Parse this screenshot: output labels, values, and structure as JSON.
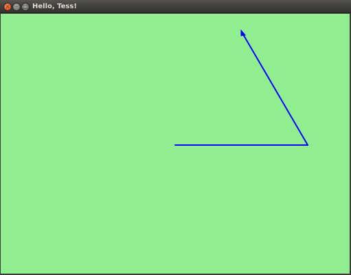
{
  "window": {
    "title": "Hello, Tess!",
    "controls": [
      {
        "name": "close",
        "glyph": "×"
      },
      {
        "name": "minimize",
        "glyph": "–"
      },
      {
        "name": "maximize",
        "glyph": "□"
      }
    ]
  },
  "canvas": {
    "background_color": "#90ee90",
    "pen_color": "#0000ff",
    "turtle_shape": "classic-arrow",
    "drawing": "two connected line segments ending at the turtle arrow"
  }
}
